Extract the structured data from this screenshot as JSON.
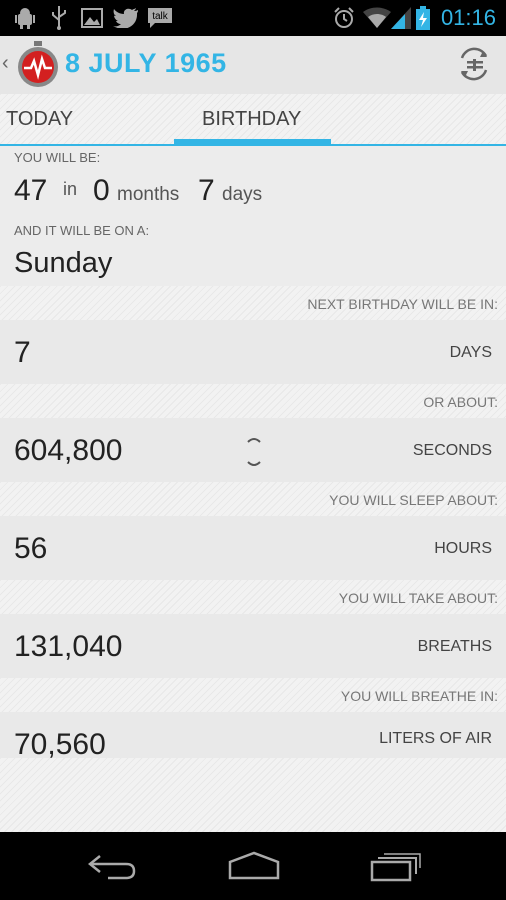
{
  "status_bar": {
    "time": "01:16",
    "left_icons": [
      "android-debug-icon",
      "usb-icon",
      "image-icon",
      "twitter-icon",
      "talk-icon"
    ],
    "talk_label": "talk",
    "right_icons": [
      "alarm-icon",
      "wifi-icon",
      "signal-icon",
      "battery-charging-icon"
    ],
    "accent_color": "#33b5e5"
  },
  "action_bar": {
    "title": "8 JULY 1965",
    "logo_icon": "heartbeat-stopwatch-icon",
    "action_icon": "sync-switch-icon"
  },
  "tabs": {
    "items": [
      {
        "label": "TODAY",
        "selected": false
      },
      {
        "label": "BIRTHDAY",
        "selected": true
      }
    ]
  },
  "summary": {
    "you_will_be_label": "YOU WILL BE:",
    "age_years": "47",
    "in_word": "in",
    "months_value": "0",
    "months_unit": "months",
    "days_value": "7",
    "days_unit": "days",
    "weekday_label": "AND IT WILL BE ON A:",
    "weekday": "Sunday"
  },
  "stats": [
    {
      "header": "NEXT BIRTHDAY WILL BE IN:",
      "value": "7",
      "unit": "DAYS"
    },
    {
      "header": "OR ABOUT:",
      "value": "604,800",
      "unit": "SECONDS"
    },
    {
      "header": "YOU WILL SLEEP ABOUT:",
      "value": "56",
      "unit": "HOURS"
    },
    {
      "header": "YOU WILL TAKE ABOUT:",
      "value": "131,040",
      "unit": "BREATHS"
    },
    {
      "header": "YOU WILL BREATHE IN:",
      "value": "70,560",
      "unit": "LITERS OF AIR"
    }
  ],
  "nav_bar": {
    "buttons": [
      "back-icon",
      "home-icon",
      "recent-apps-icon"
    ]
  }
}
